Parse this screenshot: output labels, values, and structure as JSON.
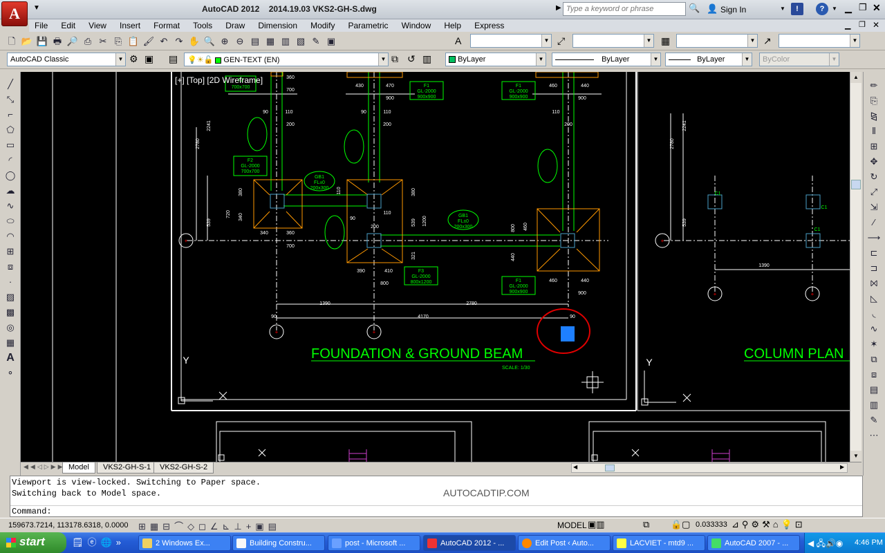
{
  "window": {
    "app_title": "AutoCAD 2012",
    "file_title": "2014.19.03 VKS2-GH-S.dwg",
    "logo_letter": "A",
    "search_placeholder": "Type a keyword or phrase",
    "sign_in": "Sign In"
  },
  "menu": [
    "File",
    "Edit",
    "View",
    "Insert",
    "Format",
    "Tools",
    "Draw",
    "Dimension",
    "Modify",
    "Parametric",
    "Window",
    "Help",
    "Express"
  ],
  "toolbar": {
    "workspace": "AutoCAD Classic",
    "layer": "GEN-TEXT (EN)",
    "color": "ByLayer",
    "linetype": "ByLayer",
    "lineweight": "ByLayer",
    "plotstyle": "ByColor"
  },
  "viewport": {
    "label": "[+] [Top] [2D Wireframe]",
    "title_left": "FOUNDATION & GROUND BEAM",
    "title_left_scale": "SCALE: 1/30",
    "title_right": "COLUMN PLAN",
    "watermark": "AUTOCADTIP.COM"
  },
  "tabs": [
    "Model",
    "VKS2-GH-S-1",
    "VKS2-GH-S-2"
  ],
  "command": {
    "line1": "Viewport is view-locked. Switching to Paper space.",
    "line2": "Switching back to Model space.",
    "prompt": "Command:"
  },
  "status": {
    "coords": "159673.7214, 113178.6318, 0.0000",
    "space": "MODEL",
    "scale": "0.033333"
  },
  "taskbar": {
    "start": "start",
    "items": [
      "2 Windows Ex...",
      "Building Constru...",
      "post - Microsoft ...",
      "AutoCAD 2012 - ...",
      "Edit Post ‹ Auto...",
      "LACVIET - mtd9 ...",
      "AutoCAD 2007 - ..."
    ],
    "active_index": 3,
    "time": "4:46 PM"
  },
  "drawing_labels": {
    "dims": [
      "360",
      "700",
      "430",
      "470",
      "900",
      "460",
      "440",
      "90",
      "110",
      "200",
      "2241",
      "2780",
      "380",
      "340",
      "720",
      "539",
      "1200",
      "410",
      "390",
      "800",
      "321",
      "110",
      "1390",
      "4170",
      "2780",
      "900",
      "460",
      "440",
      "1390"
    ],
    "tags": [
      "F1",
      "GL-2000",
      "900x900",
      "F2",
      "GL-2000",
      "700x700",
      "F3",
      "GL-2000",
      "800x1200",
      "GB1",
      "FL±0",
      "200x300",
      "C1"
    ]
  },
  "colors": {
    "drawing_bg": "#000000",
    "cad_green": "#00ff00",
    "cad_orange": "#ff9900",
    "cad_red": "#ff0000",
    "cad_white": "#ffffff",
    "highlight_blue": "#1e7fff",
    "taskbar_blue": "#245dd6"
  }
}
